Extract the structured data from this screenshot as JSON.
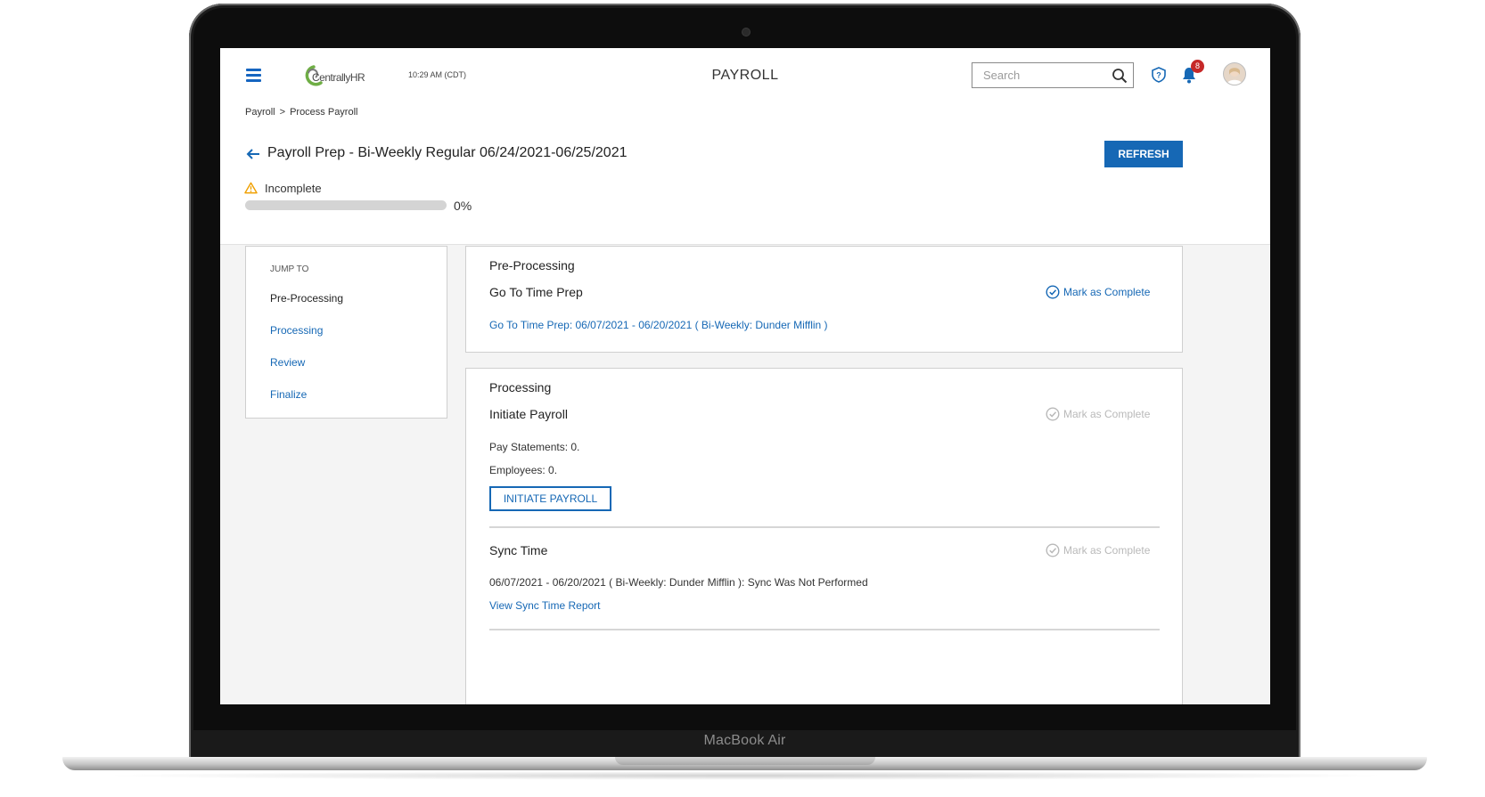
{
  "device": {
    "model_label": "MacBook Air"
  },
  "header": {
    "logo_text": "CentrallyHR",
    "time": "10:29 AM (CDT)",
    "app_title": "PAYROLL",
    "search_placeholder": "Search",
    "notifications_count": "8"
  },
  "breadcrumb": {
    "items": [
      "Payroll",
      "Process Payroll"
    ],
    "separator": ">"
  },
  "page": {
    "title": "Payroll Prep - Bi-Weekly Regular 06/24/2021-06/25/2021",
    "refresh_label": "REFRESH",
    "status": "Incomplete",
    "progress_percent": 0,
    "progress_label": "0%"
  },
  "jump_to": {
    "title": "JUMP TO",
    "items": [
      "Pre-Processing",
      "Processing",
      "Review",
      "Finalize"
    ]
  },
  "pre_processing": {
    "title": "Pre-Processing",
    "step_title": "Go To Time Prep",
    "mark_label": "Mark as Complete",
    "link": "Go To Time Prep: 06/07/2021 - 06/20/2021 ( Bi-Weekly: Dunder Mifflin )"
  },
  "processing": {
    "title": "Processing",
    "initiate": {
      "title": "Initiate Payroll",
      "mark_label": "Mark as Complete",
      "pay_statements": "Pay Statements: 0.",
      "employees": "Employees: 0.",
      "button_label": "INITIATE PAYROLL"
    },
    "sync": {
      "title": "Sync Time",
      "mark_label": "Mark as Complete",
      "status_text": "06/07/2021 - 06/20/2021 ( Bi-Weekly: Dunder Mifflin ): Sync Was Not Performed",
      "report_link": "View Sync Time Report"
    }
  },
  "colors": {
    "accent": "#1668b5",
    "badge": "#c62828",
    "warning": "#f0a000",
    "disabled": "#b9b9b9"
  }
}
